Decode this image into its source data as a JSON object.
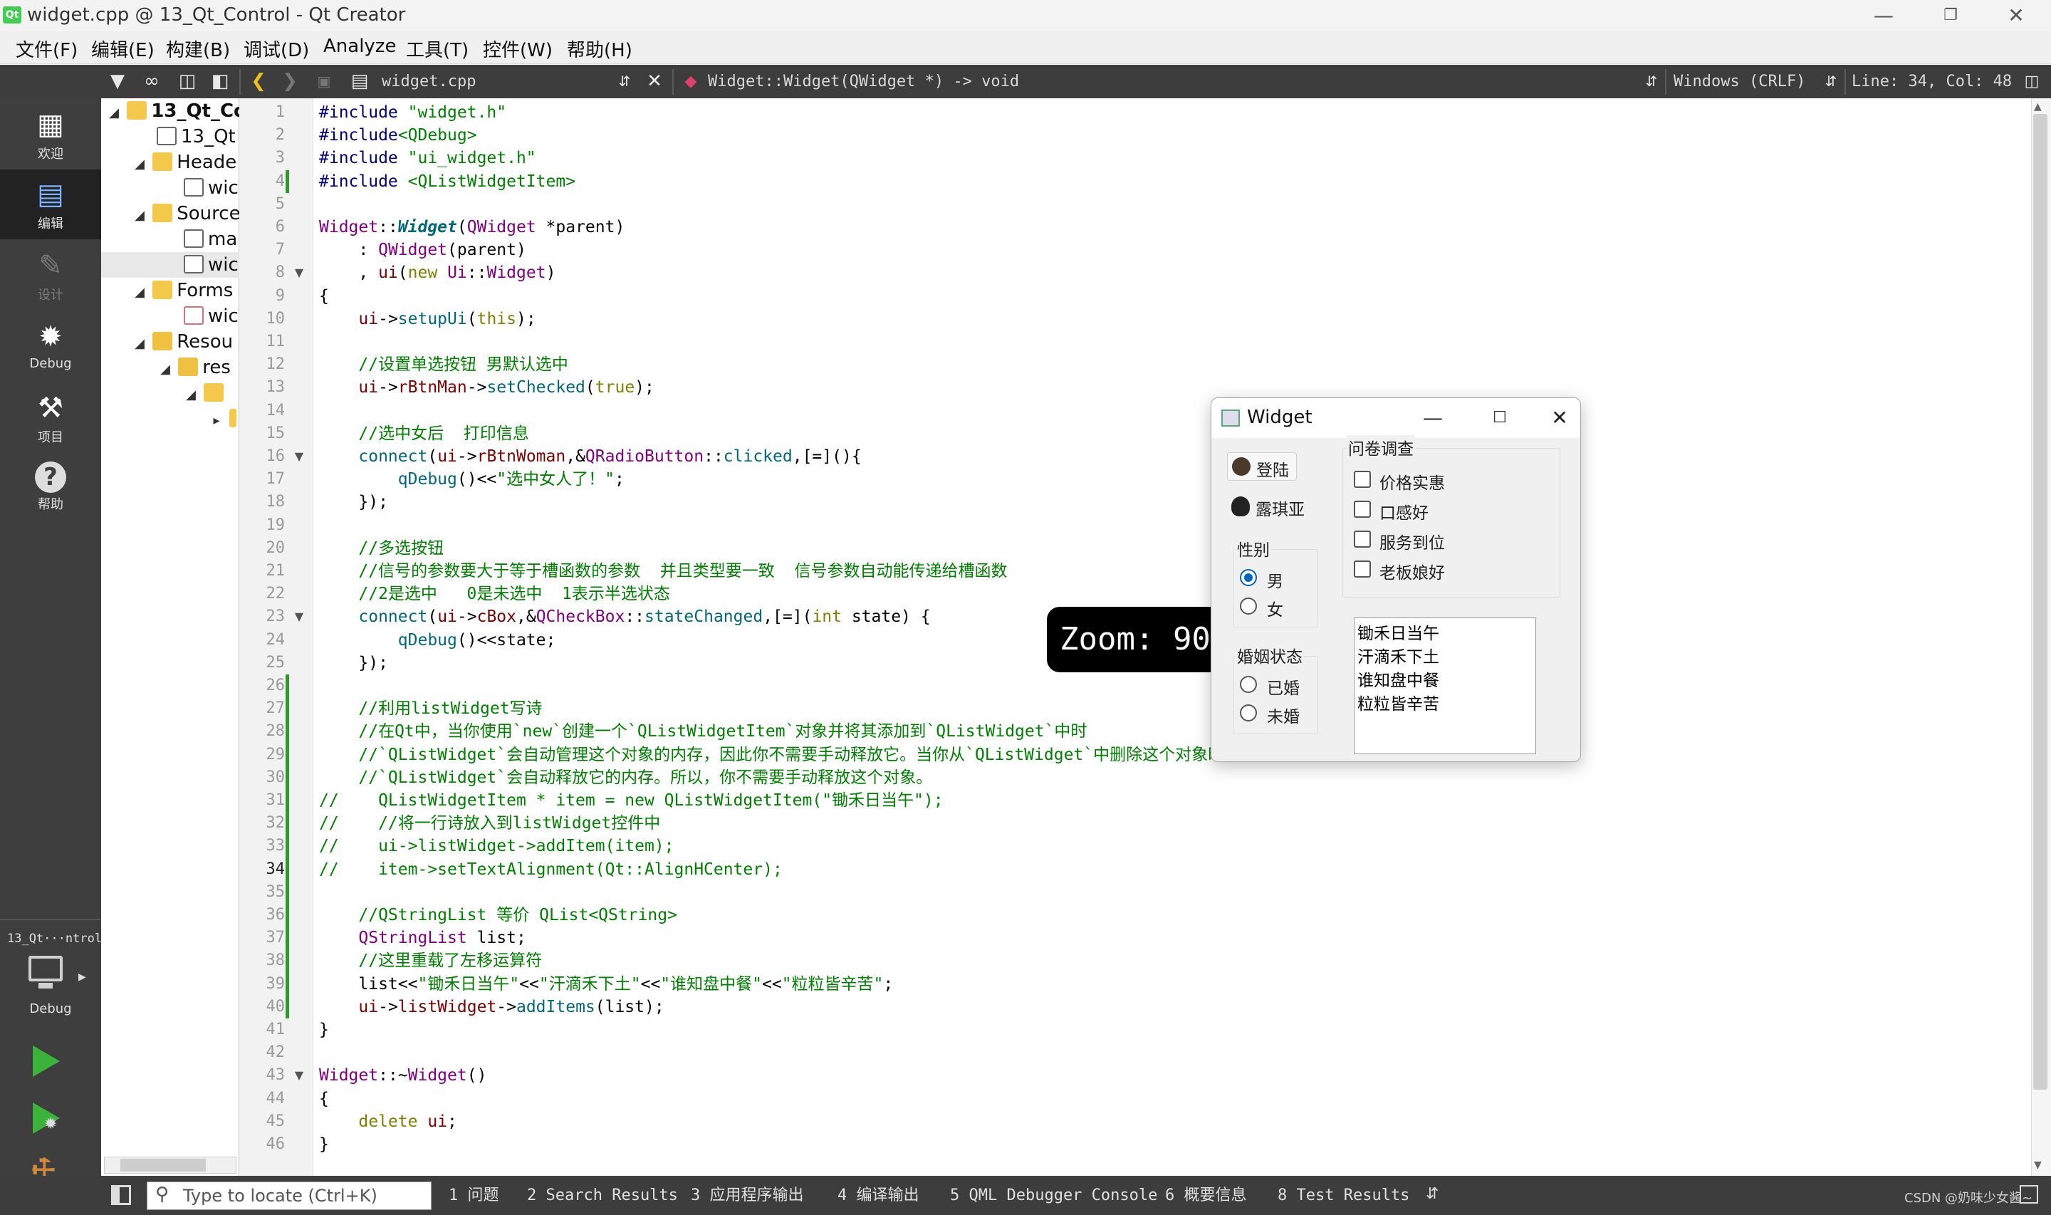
{
  "window": {
    "title": "widget.cpp @ 13_Qt_Control - Qt Creator",
    "app_icon": "Qt"
  },
  "menu": [
    "文件(F)",
    "编辑(E)",
    "构建(B)",
    "调试(D)",
    "Analyze",
    "工具(T)",
    "控件(W)",
    "帮助(H)"
  ],
  "toolbar": {
    "file": "widget.cpp",
    "symbol": "Widget::Widget(QWidget *) -> void",
    "encoding": "Windows (CRLF)",
    "position": "Line: 34, Col: 48"
  },
  "modes": [
    {
      "label": "欢迎",
      "icon": "grid-icon"
    },
    {
      "label": "编辑",
      "icon": "edit-icon"
    },
    {
      "label": "设计",
      "icon": "pencil-icon"
    },
    {
      "label": "Debug",
      "icon": "bug-icon"
    },
    {
      "label": "项目",
      "icon": "wrench-icon"
    },
    {
      "label": "帮助",
      "icon": "help-icon"
    }
  ],
  "kit": {
    "project": "13_Qt···ntrol",
    "config": "Debug"
  },
  "tree": [
    {
      "label": "13_Qt_Co",
      "bold": true
    },
    {
      "label": "13_Qt"
    },
    {
      "label": "Heade"
    },
    {
      "label": "wic"
    },
    {
      "label": "Source"
    },
    {
      "label": "ma"
    },
    {
      "label": "wic"
    },
    {
      "label": "Forms"
    },
    {
      "label": "wic"
    },
    {
      "label": "Resou"
    },
    {
      "label": "res"
    },
    {
      "label": ""
    },
    {
      "label": ""
    }
  ],
  "code": {
    "current_line": 34,
    "lines": [
      "#include \"widget.h\"",
      "#include<QDebug>",
      "#include \"ui_widget.h\"",
      "#include <QListWidgetItem>",
      "",
      "Widget::Widget(QWidget *parent)",
      "    : QWidget(parent)",
      "    , ui(new Ui::Widget)",
      "{",
      "    ui->setupUi(this);",
      "",
      "    //设置单选按钮 男默认选中",
      "    ui->rBtnMan->setChecked(true);",
      "",
      "    //选中女后  打印信息",
      "    connect(ui->rBtnWoman,&QRadioButton::clicked,[=](){",
      "        qDebug()<<\"选中女人了！\";",
      "    });",
      "",
      "    //多选按钮",
      "    //信号的参数要大于等于槽函数的参数  并且类型要一致  信号参数自动能传递给槽函数",
      "    //2是选中   0是未选中  1表示半选状态",
      "    connect(ui->cBox,&QCheckBox::stateChanged,[=](int state) {",
      "        qDebug()<<state;",
      "    });",
      "",
      "    //利用listWidget写诗",
      "    //在Qt中，当你使用`new`创建一个`QListWidgetItem`对象并将其添加到`QListWidget`中时",
      "    //`QListWidget`会自动管理这个对象的内存，因此你不需要手动释放它。当你从`QListWidget`中删除这个对象时",
      "    //`QListWidget`会自动释放它的内存。所以，你不需要手动释放这个对象。",
      "//    QListWidgetItem * item = new QListWidgetItem(\"锄禾日当午\");",
      "//    //将一行诗放入到listWidget控件中",
      "//    ui->listWidget->addItem(item);",
      "//    item->setTextAlignment(Qt::AlignHCenter);",
      "",
      "    //QStringList 等价 QList<QString>",
      "    QStringList list;",
      "    //这里重载了左移运算符",
      "    list<<\"锄禾日当午\"<<\"汗滴禾下土\"<<\"谁知盘中餐\"<<\"粒粒皆辛苦\";",
      "    ui->listWidget->addItems(list);",
      "}",
      "",
      "Widget::~Widget()",
      "{",
      "    delete ui;",
      "}"
    ]
  },
  "zoom": "Zoom: 90%",
  "widget": {
    "title": "Widget",
    "login_btn": "登陆",
    "user_btn": "露琪亚",
    "gender_group": "性别",
    "gender": [
      {
        "label": "男",
        "checked": true
      },
      {
        "label": "女",
        "checked": false
      }
    ],
    "marital_group": "婚姻状态",
    "marital": [
      {
        "label": "已婚",
        "checked": false
      },
      {
        "label": "未婚",
        "checked": false
      }
    ],
    "survey_group": "问卷调查",
    "survey": [
      "价格实惠",
      "口感好",
      "服务到位",
      "老板娘好"
    ],
    "list_items": [
      "锄禾日当午",
      "汗滴禾下土",
      "谁知盘中餐",
      "粒粒皆辛苦"
    ]
  },
  "status": {
    "locate_placeholder": "Type to locate (Ctrl+K)",
    "panes": [
      "1  问题",
      "2  Search Results",
      "3  应用程序输出",
      "4  编译输出",
      "5  QML Debugger Console",
      "6  概要信息",
      "8  Test Results"
    ],
    "watermark": "CSDN @奶味少女酱~"
  },
  "colors": {
    "accent_green": "#41cd52",
    "sidebar": "#3e3e3e",
    "radio_on": "#0067c0"
  }
}
